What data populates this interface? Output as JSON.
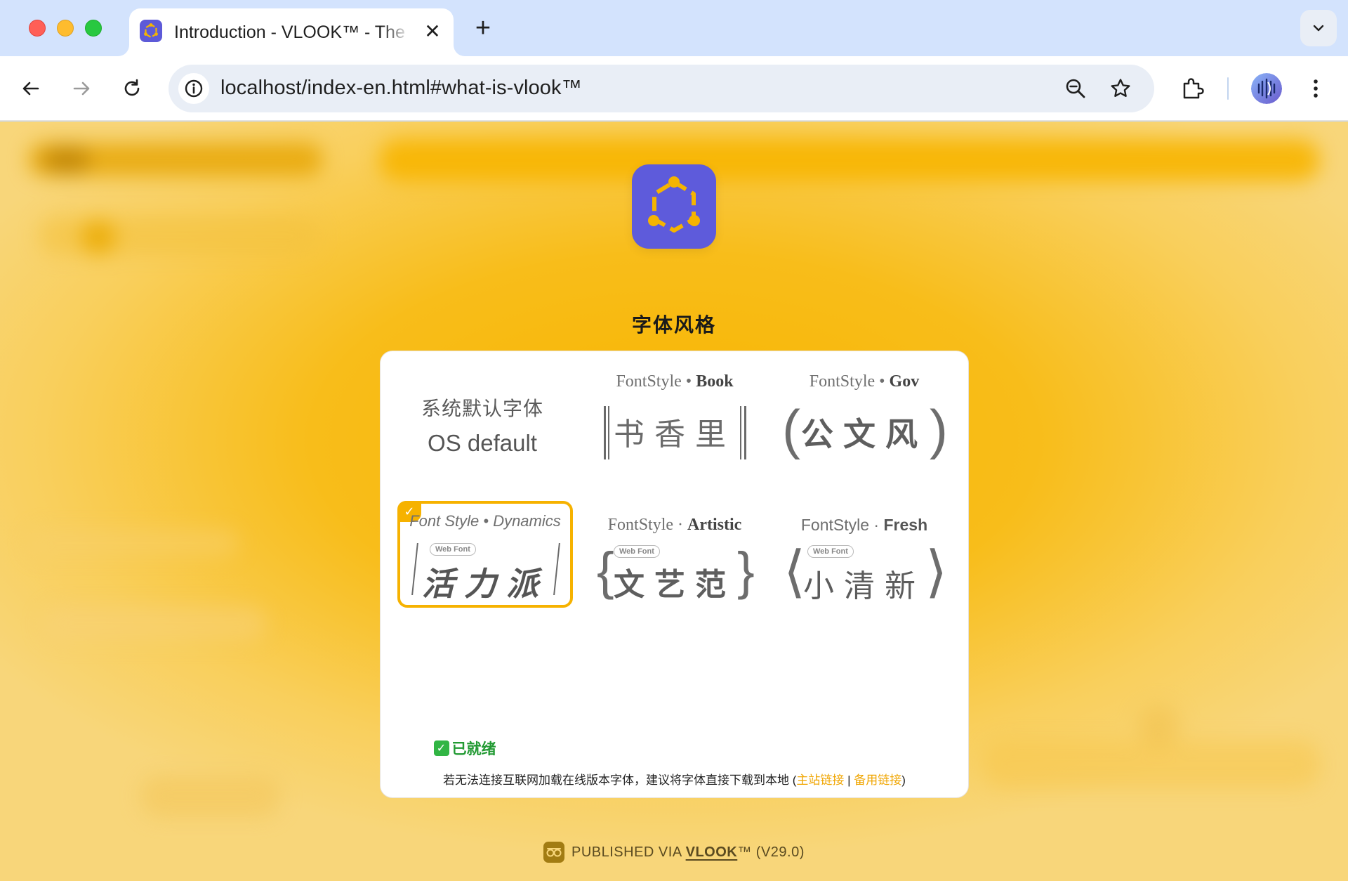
{
  "browser": {
    "tab": {
      "title": "Introduction - VLOOK™ - The Elegant & Practical THEME for Markdown",
      "close_glyph": "✕"
    },
    "new_tab_glyph": "+",
    "address": {
      "url": "localhost/index-en.html#what-is-vlook™"
    },
    "icons": [
      "back-icon",
      "forward-icon",
      "reload-icon",
      "site-info-icon",
      "zoom-icon",
      "bookmark-star-icon",
      "extensions-icon",
      "profile-avatar",
      "menu-dots-icon",
      "tab-search-chevron-icon"
    ]
  },
  "page": {
    "section_title": "字体风格",
    "options": [
      {
        "id": "os-default",
        "line1": "系统默认字体",
        "line2": "OS default"
      },
      {
        "id": "book",
        "head_prefix": "FontStyle • ",
        "head_strong": "Book",
        "glyphs": "书香里"
      },
      {
        "id": "gov",
        "head_prefix": "FontStyle • ",
        "head_strong": "Gov",
        "glyphs": "公文风"
      },
      {
        "id": "dynamics",
        "head": "Font Style • Dynamics",
        "badge": "Web Font",
        "glyphs": "活力派",
        "selected": true,
        "check": "✓"
      },
      {
        "id": "artistic",
        "head_prefix": "FontStyle · ",
        "head_strong": "Artistic",
        "badge": "Web Font",
        "glyphs": "文艺范"
      },
      {
        "id": "fresh",
        "head_prefix": "FontStyle · ",
        "head_strong": "Fresh",
        "badge": "Web Font",
        "glyphs": "小清新"
      }
    ],
    "ready": {
      "mark": "✓",
      "text": "已就绪"
    },
    "note": {
      "text": "若无法连接互联网加载在线版本字体，建议将字体直接下载到本地 (",
      "link_main": "主站链接",
      "separator": " | ",
      "link_backup": "备用链接",
      "close": ")"
    },
    "footer": {
      "prefix": "PUBLISHED VIA ",
      "brand": "VLOOK",
      "suffix": "™ (V29.0)"
    }
  },
  "colors": {
    "accent": "#f6b200",
    "brand_purple": "#5e5bdb",
    "ready_green": "#31b544",
    "link": "#f0a500"
  }
}
